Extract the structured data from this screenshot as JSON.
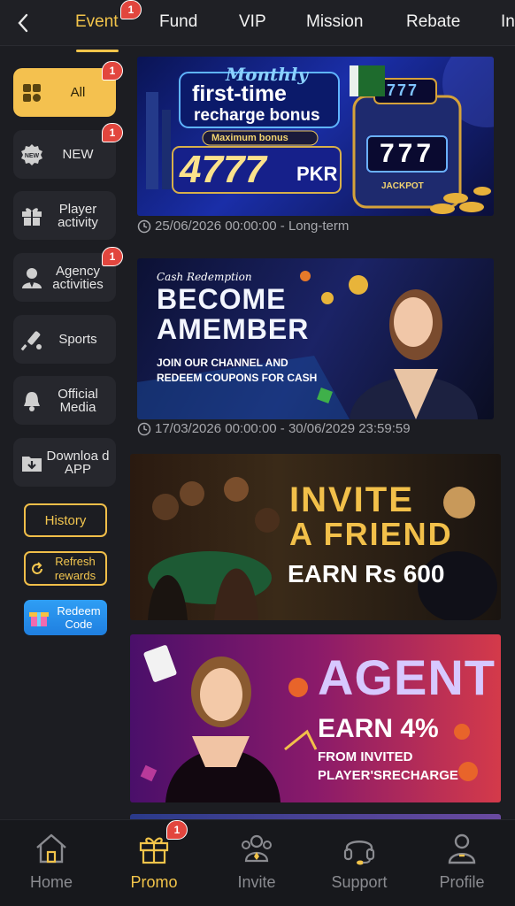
{
  "header": {
    "tabs": [
      {
        "label": "Event",
        "active": true,
        "badge": "1"
      },
      {
        "label": "Fund"
      },
      {
        "label": "VIP"
      },
      {
        "label": "Mission"
      },
      {
        "label": "Rebate"
      },
      {
        "label": "In"
      }
    ]
  },
  "sidebar": {
    "items": [
      {
        "label": "All",
        "badge": "1",
        "active": true,
        "icon": "grid-icon"
      },
      {
        "label": "NEW",
        "badge": "1",
        "icon": "new-badge-icon",
        "icon_text": "NEW"
      },
      {
        "label": "Player activity",
        "icon": "gift-icon"
      },
      {
        "label": "Agency activities",
        "badge": "1",
        "icon": "agent-icon"
      },
      {
        "label": "Sports",
        "icon": "cricket-bat-icon"
      },
      {
        "label": "Official Media",
        "icon": "bell-icon"
      },
      {
        "label": "Downloa d APP",
        "icon": "download-icon"
      }
    ],
    "history": "History",
    "refresh": "Refresh rewards",
    "redeem": "Redeem Code"
  },
  "banners": [
    {
      "lines": [
        "Monthly",
        "first-time",
        "recharge bonus",
        "Maximum bonus",
        "4777",
        "PKR",
        "777",
        "JACKPOT"
      ],
      "date": "25/06/2026 00:00:00 - Long-term"
    },
    {
      "lines": [
        "Cash Redemption",
        "BECOME",
        "AMEMBER",
        "JOIN OUR CHANNEL AND",
        "REDEEM COUPONS FOR CASH"
      ],
      "date": "17/03/2026 00:00:00 - 30/06/2029 23:59:59"
    },
    {
      "lines": [
        "INVITE",
        "A FRIEND",
        "EARN Rs 600"
      ]
    },
    {
      "lines": [
        "AGENT",
        "EARN 4%",
        "FROM INVITED",
        "PLAYER'SRECHARGE"
      ]
    }
  ],
  "bottom_nav": [
    {
      "label": "Home",
      "icon": "home-icon"
    },
    {
      "label": "Promo",
      "icon": "gift-icon",
      "active": true,
      "badge": "1"
    },
    {
      "label": "Invite",
      "icon": "invite-icon"
    },
    {
      "label": "Support",
      "icon": "headset-icon"
    },
    {
      "label": "Profile",
      "icon": "profile-icon"
    }
  ],
  "colors": {
    "accent": "#f2c44a",
    "badge": "#e2463e",
    "background": "#1c1d22",
    "panel": "#26272d"
  }
}
